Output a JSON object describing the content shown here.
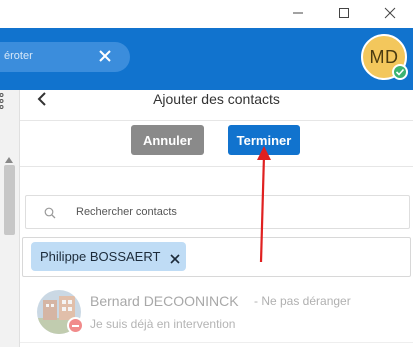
{
  "window": {
    "controls": {
      "minimize": "minimize-icon",
      "maximize": "maximize-icon",
      "close": "close-icon"
    }
  },
  "header": {
    "search_fragment": "éroter",
    "avatar_initials": "MD",
    "accent_color": "#1173ce",
    "presence_color": "#3cb371"
  },
  "panel": {
    "title": "Ajouter des contacts",
    "cancel_label": "Annuler",
    "done_label": "Terminer",
    "search_placeholder": "Rechercher contacts"
  },
  "selected_chip": {
    "label": "Philippe BOSSAERT"
  },
  "contacts": [
    {
      "name": "Bernard DECOONINCK",
      "status": " - Ne pas déranger",
      "note": "Je suis déjà en intervention",
      "status_color": "#f18b8b"
    }
  ],
  "annotation": {
    "arrow_color": "#e02020"
  }
}
